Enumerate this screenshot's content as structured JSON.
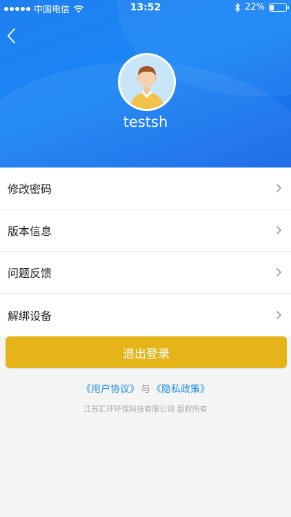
{
  "status_bar": {
    "carrier": "中国电信",
    "time": "13:52",
    "battery_percent": "22%",
    "battery_level": 0.22
  },
  "profile": {
    "username": "testsh"
  },
  "menu": {
    "items": [
      {
        "label": "修改密码"
      },
      {
        "label": "版本信息"
      },
      {
        "label": "问题反馈"
      },
      {
        "label": "解绑设备"
      }
    ]
  },
  "actions": {
    "logout_label": "退出登录"
  },
  "footer": {
    "user_agreement": "《用户协议》",
    "and": "与",
    "privacy_policy": "《隐私政策》",
    "copyright": "江苏汇环环保科技有限公司 版权所有"
  },
  "colors": {
    "header_blue": "#1a86f5",
    "logout_yellow": "#e5b418",
    "link_blue": "#1e8fe6"
  }
}
